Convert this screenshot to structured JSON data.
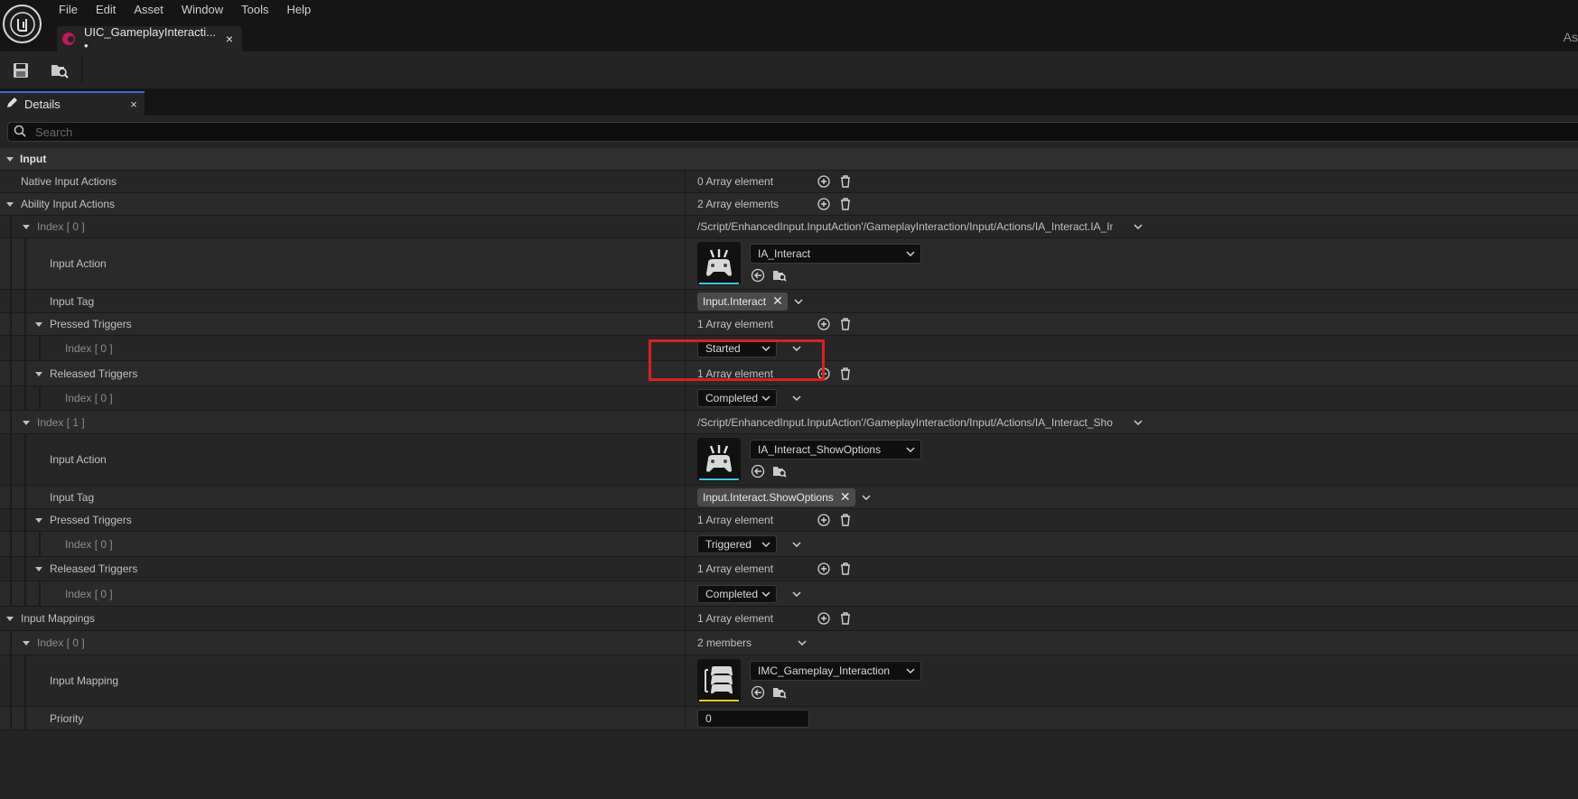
{
  "menu": [
    "File",
    "Edit",
    "Asset",
    "Window",
    "Tools",
    "Help"
  ],
  "document_tab": {
    "title": "UIC_GameplayInteracti... •",
    "close": "×"
  },
  "top_right_label": "As",
  "panel": {
    "title": "Details",
    "close": "×"
  },
  "search": {
    "placeholder": "Search"
  },
  "rows": {
    "input": {
      "label": "Input"
    },
    "native": {
      "label": "Native Input Actions",
      "value": "0 Array element"
    },
    "ability": {
      "label": "Ability Input Actions",
      "value": "2 Array elements"
    },
    "idx0": {
      "label": "Index [ 0 ]",
      "value": "/Script/EnhancedInput.InputAction'/GameplayInteraction/Input/Actions/IA_Interact.IA_Interact'"
    },
    "idx0_action": {
      "label": "Input Action",
      "value": "IA_Interact"
    },
    "idx0_tag": {
      "label": "Input Tag",
      "value": "Input.Interact"
    },
    "idx0_pressed": {
      "label": "Pressed Triggers",
      "value": "1 Array element"
    },
    "idx0_pressed_0": {
      "label": "Index [ 0 ]",
      "value": "Started"
    },
    "idx0_released": {
      "label": "Released Triggers",
      "value": "1 Array element"
    },
    "idx0_released_0": {
      "label": "Index [ 0 ]",
      "value": "Completed"
    },
    "idx1": {
      "label": "Index [ 1 ]",
      "value": "/Script/EnhancedInput.InputAction'/GameplayInteraction/Input/Actions/IA_Interact_ShowOptions.IA_Interact_ShowOptions'"
    },
    "idx1_action": {
      "label": "Input Action",
      "value": "IA_Interact_ShowOptions"
    },
    "idx1_tag": {
      "label": "Input Tag",
      "value": "Input.Interact.ShowOptions"
    },
    "idx1_pressed": {
      "label": "Pressed Triggers",
      "value": "1 Array element"
    },
    "idx1_pressed_0": {
      "label": "Index [ 0 ]",
      "value": "Triggered"
    },
    "idx1_released": {
      "label": "Released Triggers",
      "value": "1 Array element"
    },
    "idx1_released_0": {
      "label": "Index [ 0 ]",
      "value": "Completed"
    },
    "mappings": {
      "label": "Input Mappings",
      "value": "1 Array element"
    },
    "map0": {
      "label": "Index [ 0 ]",
      "value": "2 members"
    },
    "map0_mapping": {
      "label": "Input Mapping",
      "value": "IMC_Gameplay_Interaction"
    },
    "map0_priority": {
      "label": "Priority",
      "value": "0"
    }
  },
  "colors": {
    "accent_blue": "#2f6fd4",
    "highlight_red": "#d9201c",
    "action_bar": "#3fc6e8",
    "mapping_bar": "#e6d020",
    "tab_icon": "#c2185b"
  }
}
